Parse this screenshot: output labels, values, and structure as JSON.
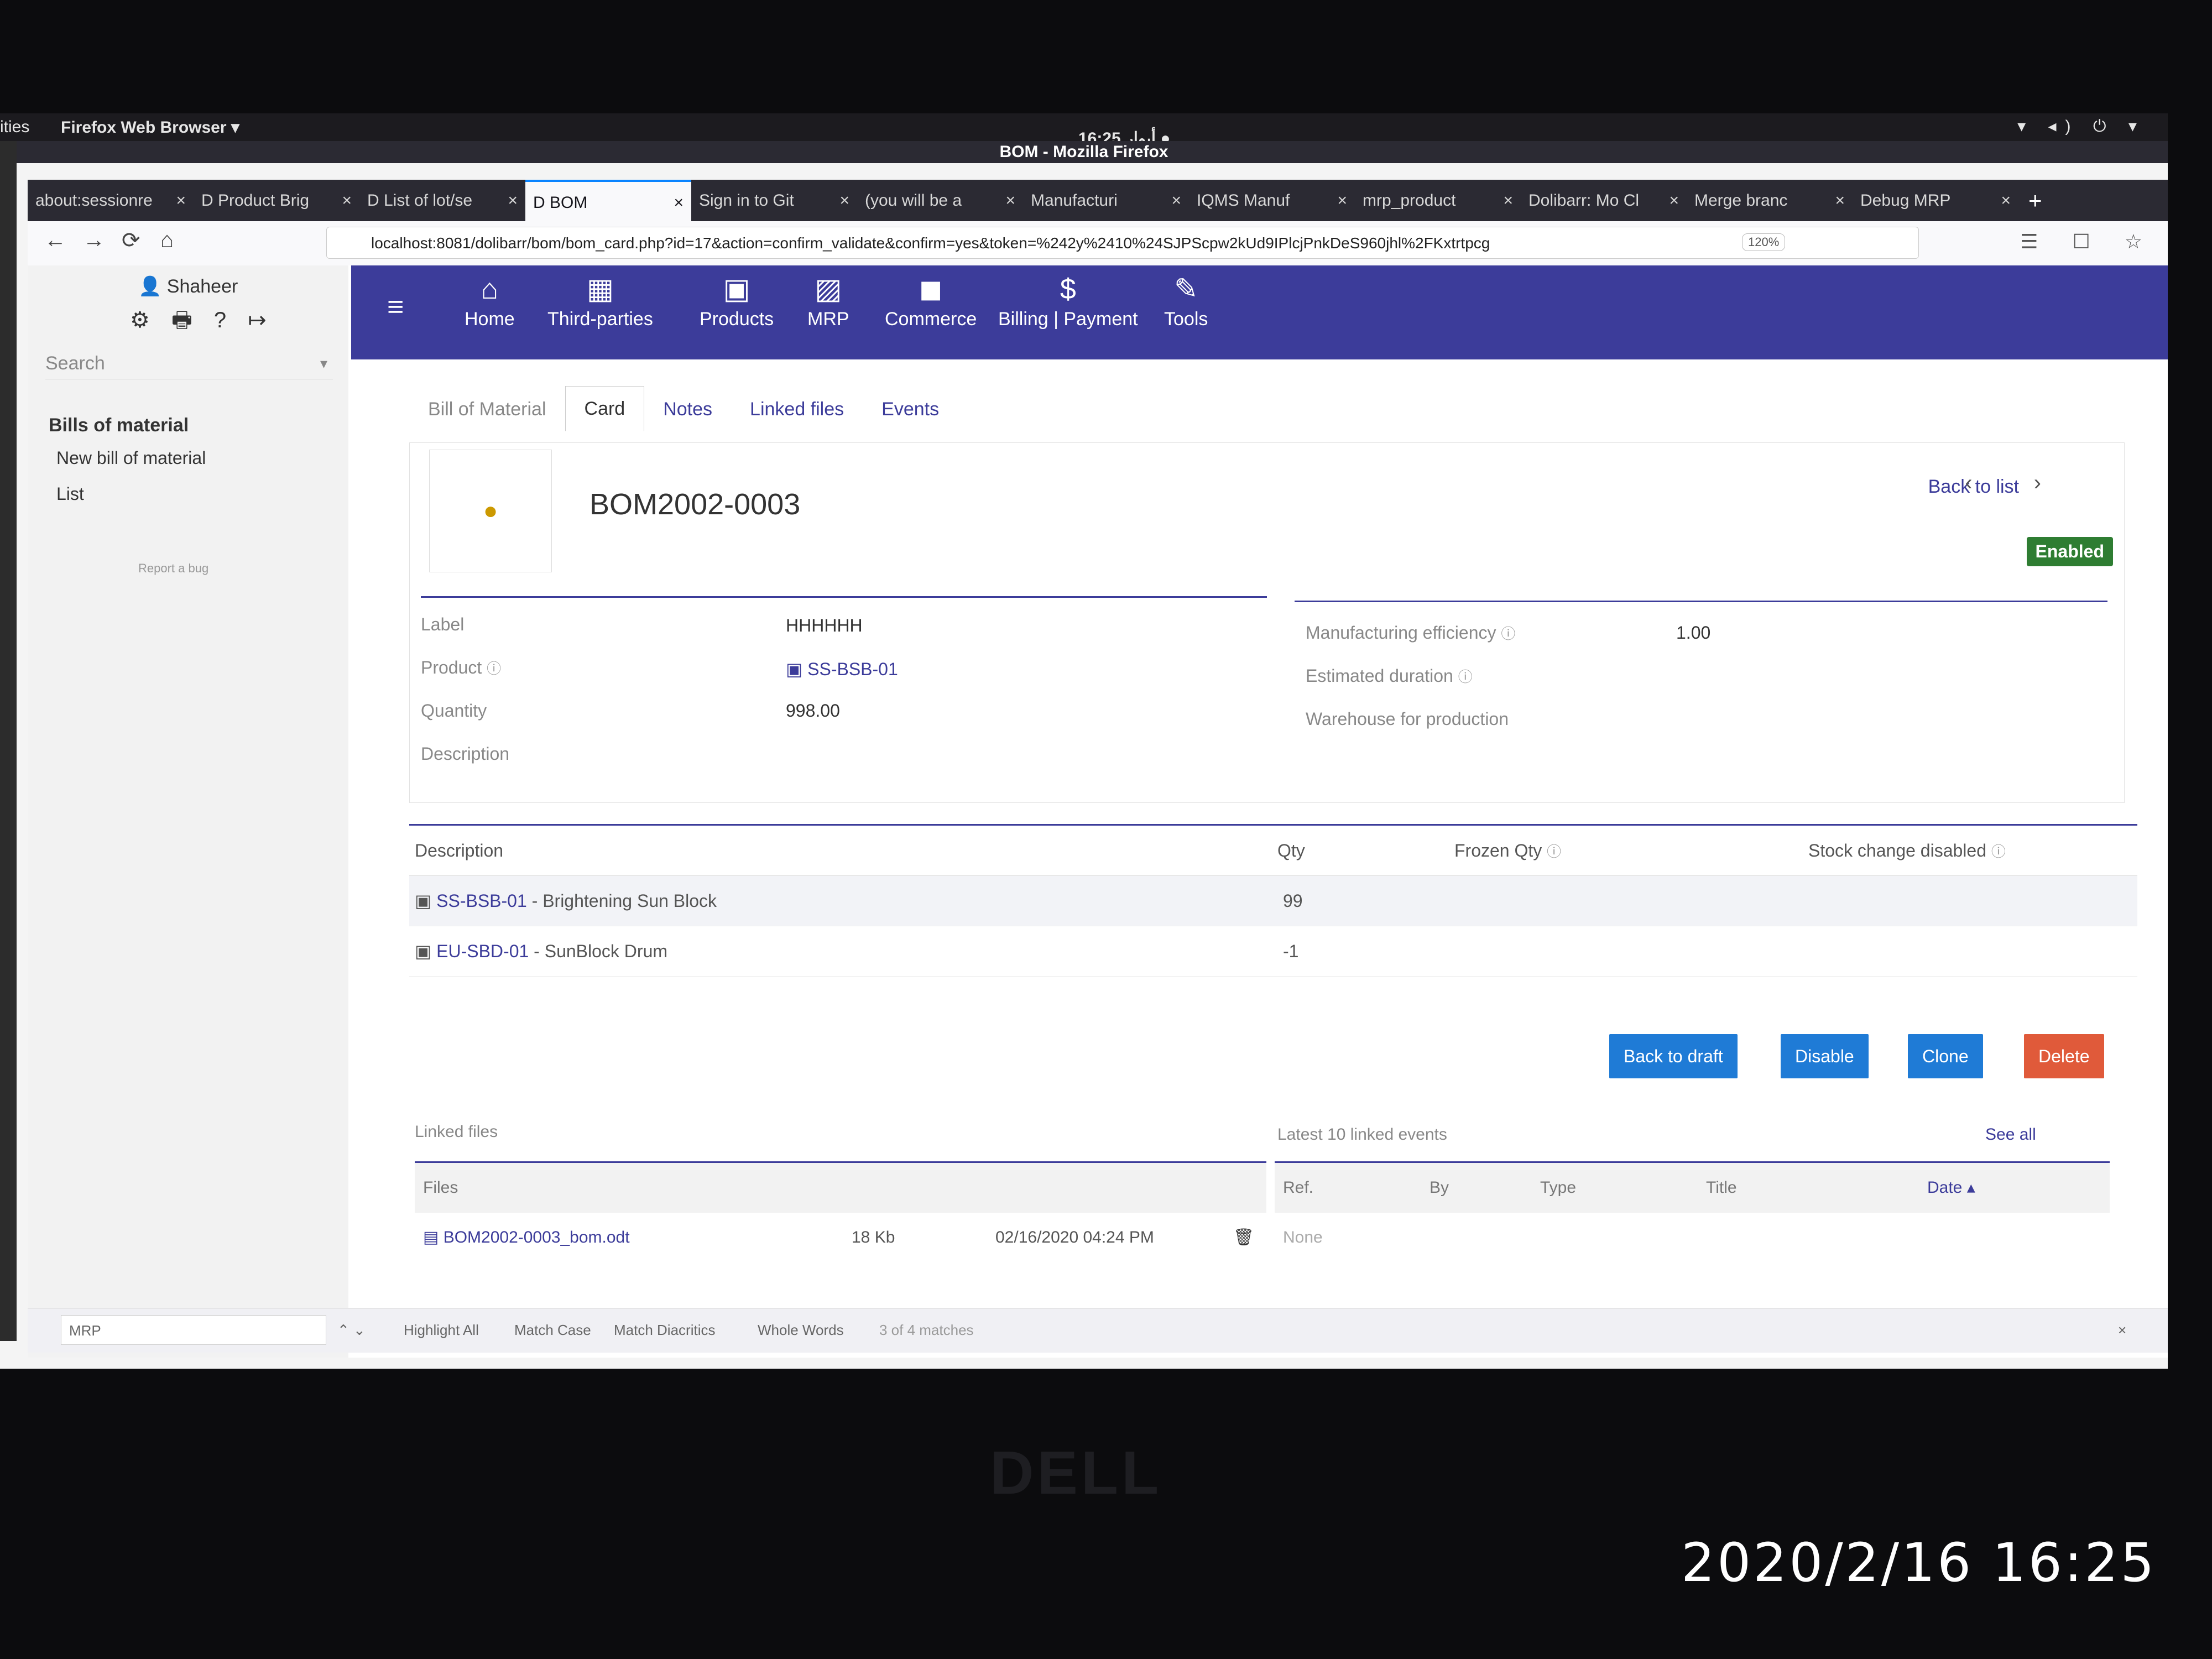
{
  "gnome": {
    "activities": "ities",
    "app_menu": "Firefox Web Browser ▾",
    "clock": "16:25 أبوار ●",
    "tray": "▾ ◂) ⏻ ▾"
  },
  "window_title": "BOM - Mozilla Firefox",
  "tabs": [
    {
      "label": "about:sessionre",
      "close": "×"
    },
    {
      "label": "D Product Brig",
      "close": "×"
    },
    {
      "label": "D List of lot/se",
      "close": "×"
    },
    {
      "label": "D BOM",
      "close": "×"
    },
    {
      "label": "Sign in to Git",
      "close": "×"
    },
    {
      "label": "(you will be a",
      "close": "×"
    },
    {
      "label": "Manufacturi",
      "close": "×"
    },
    {
      "label": "IQMS Manuf",
      "close": "×"
    },
    {
      "label": "mrp_product",
      "close": "×"
    },
    {
      "label": "Dolibarr: Mo Cl",
      "close": "×"
    },
    {
      "label": "Merge branc",
      "close": "×"
    },
    {
      "label": "Debug MRP",
      "close": "×"
    }
  ],
  "new_tab": "+",
  "nav": {
    "back": "←",
    "forward": "→",
    "reload": "⟳",
    "home": "⌂",
    "url": "localhost:8081/dolibarr/bom/bom_card.php?id=17&action=confirm_validate&confirm=yes&token=%242y%2410%24SJPScpw2kUd9IPlcjPnkDeS960jhl%2FKxtrtpcg",
    "zoom": "120%",
    "right_icons": "☰ ☐ ☆"
  },
  "sidebar": {
    "user": "Shaheer",
    "user_icons": "⚙ 🖶 ? ↦",
    "search_placeholder": "Search",
    "search_caret": "▾",
    "heading": "Bills of material",
    "items": [
      "New bill of material",
      "List"
    ],
    "report": "Report a bug"
  },
  "topmenu": [
    {
      "icon": "⌂",
      "label": "Home"
    },
    {
      "icon": "▦",
      "label": "Third-parties"
    },
    {
      "icon": "▣",
      "label": "Products"
    },
    {
      "icon": "▨",
      "label": "MRP"
    },
    {
      "icon": "◼",
      "label": "Commerce"
    },
    {
      "icon": "$",
      "label": "Billing | Payment"
    },
    {
      "icon": "✎",
      "label": "Tools"
    }
  ],
  "hamburger": "≡",
  "subtabs": [
    "Bill of Material",
    "Card",
    "Notes",
    "Linked files",
    "Events"
  ],
  "bom": {
    "ref": "BOM2002-0003",
    "back_to_list": "Back to list",
    "pager": "‹ ›",
    "status": "Enabled",
    "fields_left": [
      {
        "label": "Label",
        "value": "HHHHHH"
      },
      {
        "label": "Product",
        "value": "SS-BSB-01"
      },
      {
        "label": "Quantity",
        "value": "998.00"
      },
      {
        "label": "Description",
        "value": ""
      }
    ],
    "fields_right": [
      {
        "label": "Manufacturing efficiency",
        "value": "1.00"
      },
      {
        "label": "Estimated duration",
        "value": ""
      },
      {
        "label": "Warehouse for production",
        "value": ""
      }
    ]
  },
  "lines": {
    "headers": [
      "Description",
      "Qty",
      "Frozen Qty",
      "Stock change disabled"
    ],
    "rows": [
      {
        "ref": "SS-BSB-01",
        "label": " - Brightening Sun Block",
        "qty": "99"
      },
      {
        "ref": "EU-SBD-01",
        "label": " - SunBlock Drum",
        "qty": "-1"
      }
    ]
  },
  "actions": [
    {
      "label": "Back to draft",
      "color": "#1f7bd6"
    },
    {
      "label": "Disable",
      "color": "#1f7bd6"
    },
    {
      "label": "Clone",
      "color": "#1f7bd6"
    },
    {
      "label": "Delete",
      "color": "#e05a3a"
    }
  ],
  "linked_files": {
    "title": "Linked files",
    "header": "Files",
    "file": {
      "name": "BOM2002-0003_bom.odt",
      "size": "18 Kb",
      "date": "02/16/2020 04:24 PM"
    }
  },
  "events": {
    "title": "Latest 10 linked events",
    "see_all": "See all",
    "headers": [
      "Ref.",
      "By",
      "Type",
      "Title",
      "Date ▴"
    ],
    "empty": "None"
  },
  "findbar": {
    "query": "MRP",
    "arrows": "⌃ ⌄",
    "options": [
      "Highlight All",
      "Match Case",
      "Match Diacritics",
      "Whole Words"
    ],
    "matches": "3 of 4 matches",
    "close": "×"
  },
  "bezel_logo": "DELL",
  "photo_timestamp": "2020/2/16  16:25",
  "colors": {
    "nav": "#3c3c9a",
    "enabled": "#2e7d32",
    "button": "#1f7bd6",
    "delete": "#e05a3a"
  }
}
